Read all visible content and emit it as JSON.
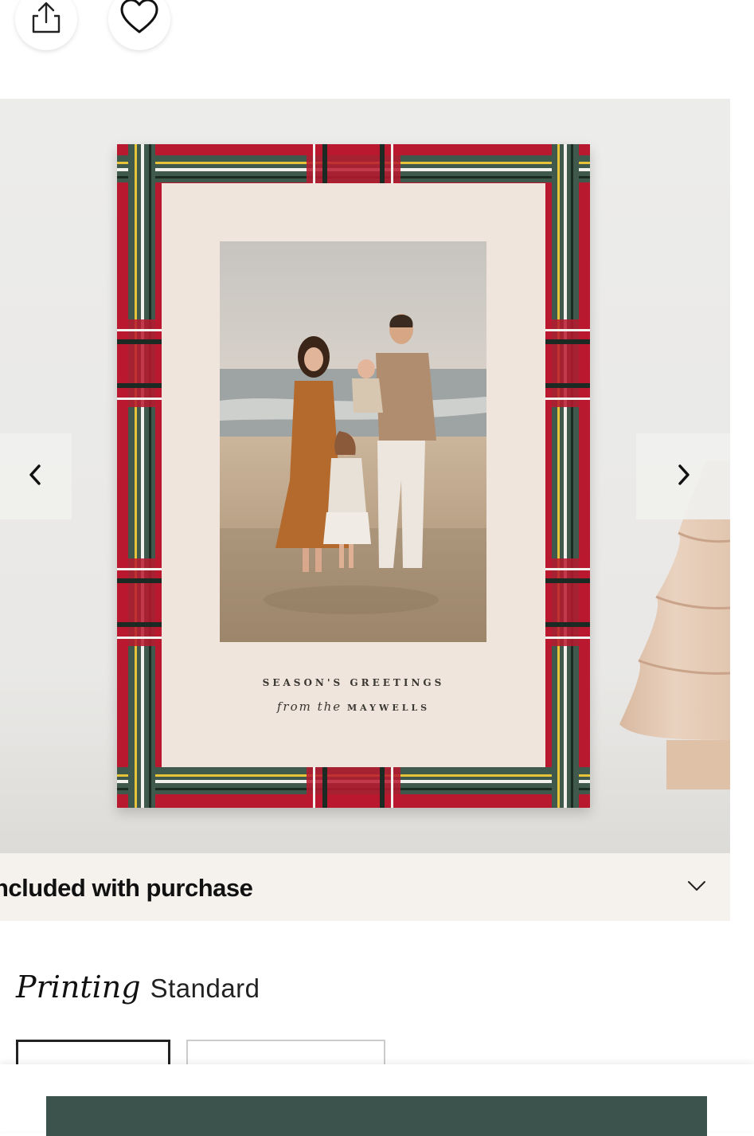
{
  "header": {
    "share_icon": "share-icon",
    "favorite_icon": "heart-icon"
  },
  "product": {
    "card_line1": "SEASON'S GREETINGS",
    "card_line2_script": "from the",
    "card_line2_name": "MAYWELLS"
  },
  "gallery": {
    "prev_icon": "chevron-left-icon",
    "next_icon": "chevron-right-icon"
  },
  "included": {
    "label": "ncluded with purchase",
    "toggle_icon": "chevron-down-icon"
  },
  "printing": {
    "label": "Printing",
    "value": "Standard"
  },
  "colors": {
    "accent": "#3c524d",
    "plaid_red": "#b8192e",
    "plaid_green": "#3f5a4c",
    "card_background": "#efe5dc"
  }
}
